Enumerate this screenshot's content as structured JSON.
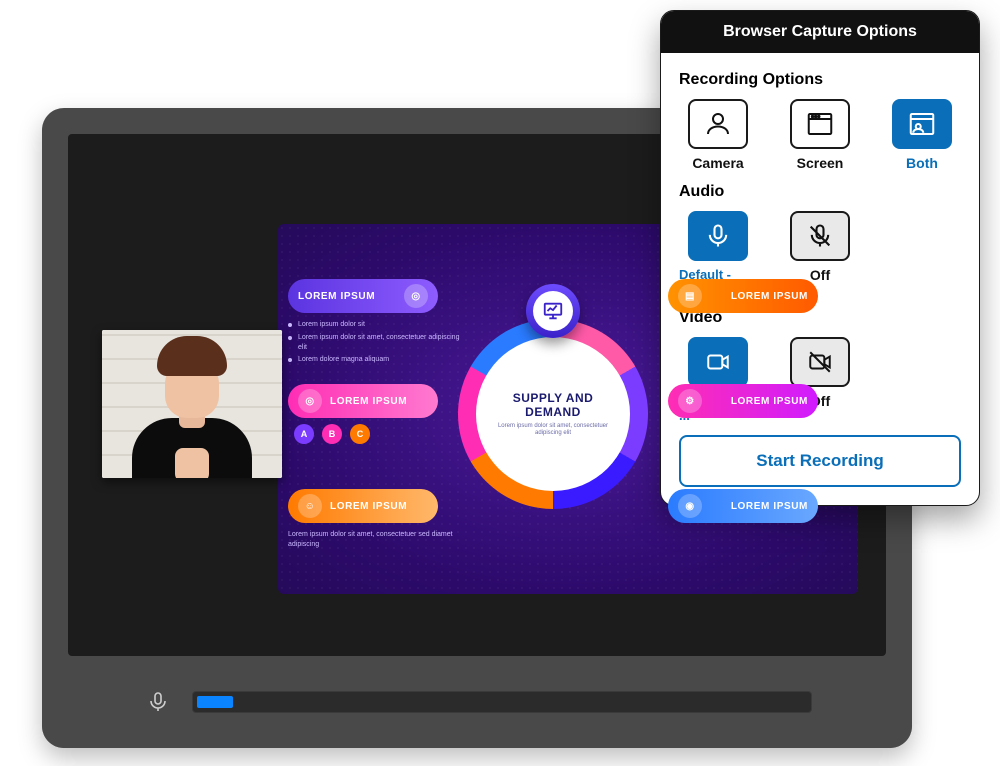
{
  "panel": {
    "title": "Browser Capture Options",
    "sections": {
      "recording": {
        "title": "Recording Options",
        "options": [
          {
            "label": "Camera"
          },
          {
            "label": "Screen"
          },
          {
            "label": "Both"
          }
        ]
      },
      "audio": {
        "title": "Audio",
        "default_label": "Default - ...",
        "off_label": "Off"
      },
      "video": {
        "title": "Video",
        "default_label": "Default - ...",
        "off_label": "Off"
      }
    },
    "start_button": "Start Recording"
  },
  "slide": {
    "center_title": "SUPPLY AND DEMAND",
    "center_sub": "Lorem ipsum dolor sit amet, consectetuer adipiscing elit",
    "pills": {
      "p1": "LOREM IPSUM",
      "p2": "LOREM IPSUM",
      "p3": "LOREM IPSUM",
      "p4": "LOREM IPSUM",
      "p5": "LOREM IPSUM",
      "p6": "LOREM IPSUM"
    },
    "bullets": [
      "Lorem ipsum dolor sit",
      "Lorem ipsum dolor sit amet, consectetuer adipiscing elit",
      "Lorem dolore magna aliquam"
    ],
    "abc": [
      "A",
      "B",
      "C"
    ],
    "sub2": "Lorem ipsum dolor sit amet, consectetuer sed diamet adipiscing"
  }
}
